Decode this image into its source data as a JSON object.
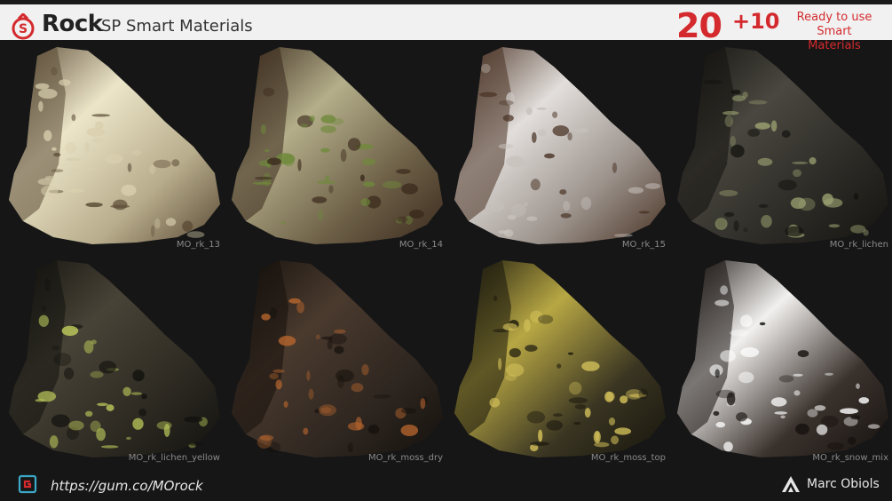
{
  "header": {
    "brand": "Rock",
    "subtitle": "SP Smart Materials",
    "count_main": "20",
    "count_extra": "+10",
    "ready_line1": "Ready to use",
    "ready_line2": "Smart Materials"
  },
  "materials": [
    {
      "label": "MO_rk_13",
      "base": "#b8ad8c",
      "light": "#ece5c8",
      "dark": "#5a4a35",
      "spot": "#d8cfae"
    },
    {
      "label": "MO_rk_14",
      "base": "#6d6047",
      "light": "#b4ae8a",
      "dark": "#3a2a1d",
      "spot": "#6f8a3a"
    },
    {
      "label": "MO_rk_15",
      "base": "#9a918a",
      "light": "#e2dedb",
      "dark": "#4a3325",
      "spot": "#c8c2bd"
    },
    {
      "label": "MO_rk_lichen",
      "base": "#2c2a25",
      "light": "#4a4740",
      "dark": "#14130f",
      "spot": "#9aa070"
    },
    {
      "label": "MO_rk_lichen_yellow",
      "base": "#2d2a22",
      "light": "#484337",
      "dark": "#13120e",
      "spot": "#b8c65a"
    },
    {
      "label": "MO_rk_moss_dry",
      "base": "#2e2620",
      "light": "#4a3a2e",
      "dark": "#15110d",
      "spot": "#b8662e"
    },
    {
      "label": "MO_rk_moss_top",
      "base": "#3a3522",
      "light": "#b7a744",
      "dark": "#17150d",
      "spot": "#d4c15a"
    },
    {
      "label": "MO_rk_snow_mix",
      "base": "#3a322d",
      "light": "#f2f0ee",
      "dark": "#17120f",
      "spot": "#ffffff"
    }
  ],
  "footer": {
    "url": "https://gum.co/MOrock",
    "author": "Marc Obiols"
  },
  "colors": {
    "accent": "#d42a2e",
    "header_bg": "#f1f1f1",
    "page_bg": "#161616"
  },
  "icons": {
    "logo": "rock-logo-icon",
    "link": "gumroad-icon",
    "author": "author-logo-icon"
  }
}
